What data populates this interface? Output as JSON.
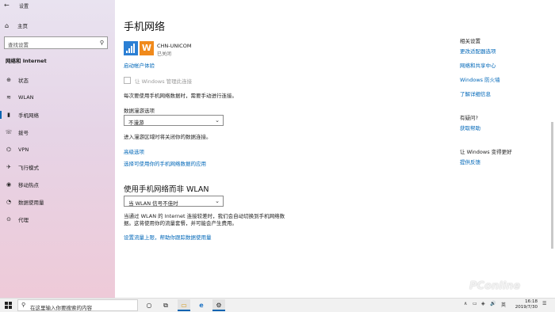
{
  "window": {
    "title": "设置",
    "back_glyph": "←",
    "minimize": "—",
    "maximize": "☐",
    "close": "✕"
  },
  "sidebar": {
    "home": "主页",
    "search_placeholder": "查找设置",
    "section": "网络和 Internet",
    "items": [
      {
        "label": "状态",
        "icon": "globe-icon",
        "glyph": "⊕"
      },
      {
        "label": "WLAN",
        "icon": "wifi-icon",
        "glyph": "≋"
      },
      {
        "label": "手机网络",
        "icon": "cellular-icon",
        "glyph": "▮"
      },
      {
        "label": "拨号",
        "icon": "dialup-icon",
        "glyph": "☏"
      },
      {
        "label": "VPN",
        "icon": "vpn-icon",
        "glyph": "⌬"
      },
      {
        "label": "飞行模式",
        "icon": "airplane-icon",
        "glyph": "✈"
      },
      {
        "label": "移动热点",
        "icon": "hotspot-icon",
        "glyph": "◉"
      },
      {
        "label": "数据使用量",
        "icon": "data-usage-icon",
        "glyph": "◔"
      },
      {
        "label": "代理",
        "icon": "proxy-icon",
        "glyph": "⊙"
      }
    ]
  },
  "main": {
    "title": "手机网络",
    "carrier_name": "CHN-UNICOM",
    "carrier_status": "已关闭",
    "carrier_logo_glyph": "W",
    "activate_link": "启动帐户体验",
    "checkbox_label": "让 Windows 管理此连接",
    "notice": "每次要使用手机网络数据时，需要手动进行连接。",
    "roaming_label": "数据漫游选项",
    "roaming_value": "不漫游",
    "roaming_desc": "进入漫游区域时将关闭你的数据连接。",
    "advanced_link": "高级选项",
    "apps_link": "选择可使用你的手机网络数据的应用",
    "section_title": "使用手机网络而非 WLAN",
    "wlan_value": "当 WLAN 信号不佳时",
    "wlan_desc_line1": "当通过 WLAN 的 Internet 连接较差时，我们会自动切换到手机网络数",
    "wlan_desc_line2": "据。这将使用你的流量套餐，并可能会产生费用。",
    "limit_link": "设置流量上限，帮助你跟踪数据使用量"
  },
  "right": {
    "related_heading": "相关设置",
    "related_links": [
      "更改适配器选项",
      "网络和共享中心",
      "Windows 防火墙",
      "了解详细信息"
    ],
    "help_heading": "有疑问?",
    "help_link": "获取帮助",
    "improve_heading": "让 Windows 变得更好",
    "feedback_link": "提供反馈"
  },
  "watermark": "PConline",
  "taskbar": {
    "search_placeholder": "在这里输入你要搜索的内容",
    "time": "16:18",
    "date": "2019/7/30",
    "apps": [
      {
        "name": "cortana-icon",
        "glyph": "○"
      },
      {
        "name": "task-view-icon",
        "glyph": "⧉"
      },
      {
        "name": "file-explorer-icon",
        "glyph": "▭"
      },
      {
        "name": "edge-icon",
        "glyph": "e"
      },
      {
        "name": "settings-icon",
        "glyph": "⚙"
      }
    ],
    "tray": [
      "∧",
      "▭",
      "◈",
      "🔊",
      "英",
      "☰"
    ]
  }
}
